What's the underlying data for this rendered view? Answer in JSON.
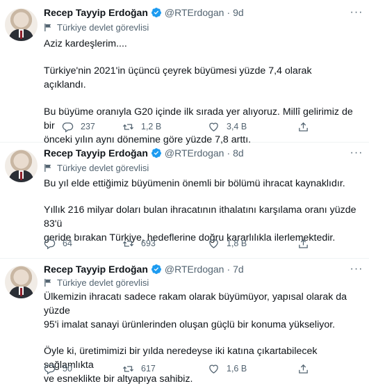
{
  "tweets": [
    {
      "name": "Recep Tayyip Erdoğan",
      "handle": "@RTErdogan",
      "time": "9d",
      "label": "Türkiye devlet görevlisi",
      "paragraphs": [
        "Aziz kardeşlerim....",
        "Türkiye'nin 2021'in üçüncü çeyrek büyümesi yüzde 7,4 olarak açıklandı.",
        "Bu büyüme oranıyla G20 içinde ilk sırada yer alıyoruz. Millî gelirimiz de bir\nönceki yılın aynı dönemine göre yüzde 7,8 arttı."
      ],
      "replies": "237",
      "retweets": "1,2 B",
      "likes": "3,4 B"
    },
    {
      "name": "Recep Tayyip Erdoğan",
      "handle": "@RTErdogan",
      "time": "8d",
      "label": "Türkiye devlet görevlisi",
      "paragraphs": [
        "Bu yıl elde ettiğimiz büyümenin önemli bir bölümü ihracat kaynaklıdır.",
        "Yıllık 216 milyar doları bulan ihracatının ithalatını karşılama oranı yüzde 83'ü\ngeride bırakan Türkiye, hedeflerine doğru kararlılıkla ilerlemektedir."
      ],
      "replies": "64",
      "retweets": "693",
      "likes": "1,8 B"
    },
    {
      "name": "Recep Tayyip Erdoğan",
      "handle": "@RTErdogan",
      "time": "7d",
      "label": "Türkiye devlet görevlisi",
      "paragraphs": [
        "Ülkemizin ihracatı sadece rakam olarak büyümüyor, yapısal olarak da yüzde\n95'i imalat sanayi ürünlerinden oluşan güçlü bir konuma yükseliyor.",
        "Öyle ki, üretimimizi bir yılda neredeyse iki katına çıkartabilecek sağlamlıkta\nve esneklikte bir altyapıya sahibiz."
      ],
      "replies": "50",
      "retweets": "617",
      "likes": "1,6 B"
    }
  ],
  "separator": "·",
  "colors": {
    "verified": "#1d9bf0",
    "secondary_text": "#536471",
    "primary_text": "#0f1419",
    "divider": "#eff3f4"
  },
  "icons": {
    "verified": "verified-badge-icon",
    "label": "flag-icon",
    "reply": "reply-icon",
    "retweet": "retweet-icon",
    "like": "heart-icon",
    "share": "share-icon",
    "more": "more-options-icon"
  }
}
